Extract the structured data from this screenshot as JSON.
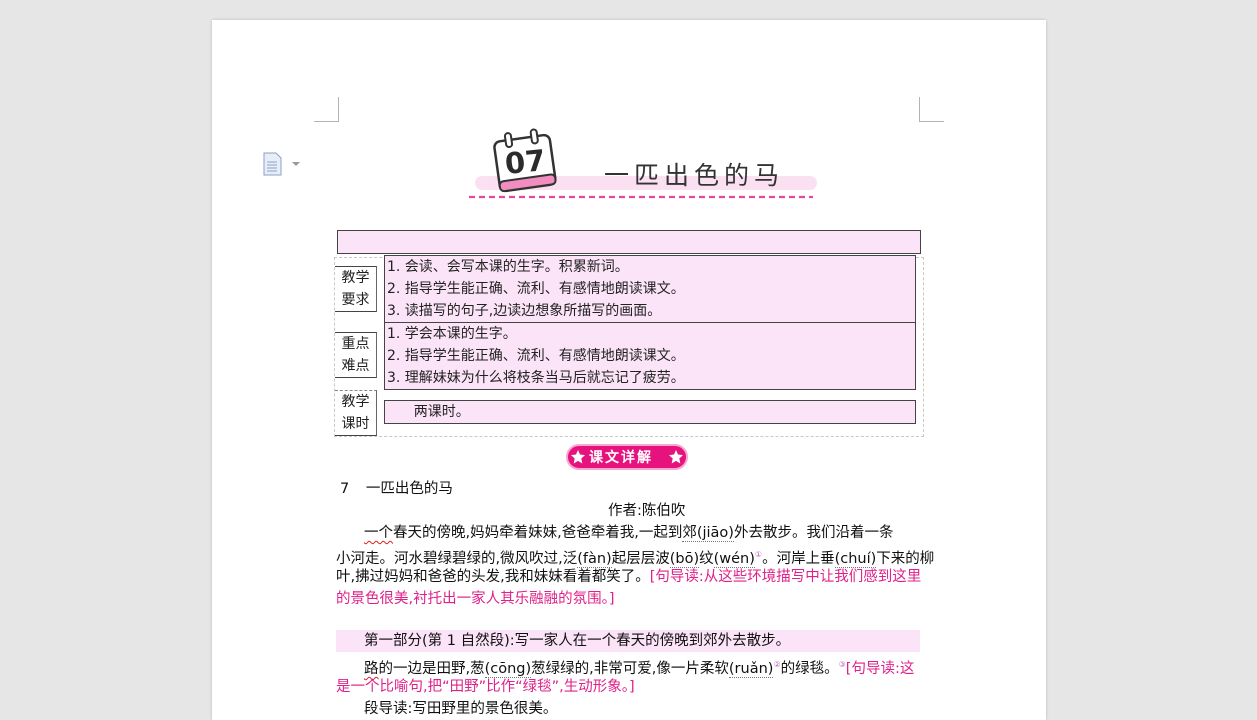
{
  "lesson": {
    "number": "07",
    "title": "一匹出色的马"
  },
  "table": {
    "header": "",
    "rows": [
      {
        "label1": "教学",
        "label2": "要求",
        "items": [
          "1. 会读、会写本课的生字。积累新词。",
          "2. 指导学生能正确、流利、有感情地朗读课文。",
          "3. 读描写的句子,边读边想象所描写的画面。"
        ]
      },
      {
        "label1": "重点",
        "label2": "难点",
        "items": [
          "1.  学会本课的生字。",
          "2. 指导学生能正确、流利、有感情地朗读课文。",
          "3. 理解妹妹为什么将枝条当马后就忘记了疲劳。"
        ]
      },
      {
        "label1": "教学",
        "label2": "课时",
        "items": [
          "      两课时。"
        ]
      }
    ]
  },
  "section_badge": "课文详解",
  "text": {
    "heading_num": "7",
    "heading_title": "一匹出色的马",
    "author": "作者:陈伯吹",
    "p1_indent": "一个",
    "p1_a": "春天的傍晚,妈妈牵着妹妹,爸爸牵着我,一起到",
    "p1_jiao": "郊(jiāo)",
    "p1_b": "外去散步。我们沿着一条",
    "p2_a": "小河走。河水碧绿碧绿的,微风吹过,泛",
    "p2_fan": "(fàn)",
    "p2_b": "起层层波",
    "p2_bo": "(bō)",
    "p2_c": "纹",
    "p2_wen": "(wén)",
    "p2_d": "。河岸上垂",
    "p2_chui": "(chuí)",
    "p2_e": "下来的柳",
    "p3_a": "叶,拂过妈妈和爸爸的头发,我和妹妹看着都笑了。",
    "p3_pink": "[句导读:从这些环境描写中让我们感到这里",
    "p4_pink": "的景色很美,衬托出一家人其乐融融的氛围。]",
    "part1": "第一部分(第 1 自然段):写一家人在一个春天的傍晚到郊外去散步。",
    "p5_indent": "路",
    "p5_a": "的一边是田野,葱",
    "p5_cong": "(cōng)",
    "p5_b": "葱绿绿的,非常可爱,像一片柔软",
    "p5_ruan": "(ruǎn)",
    "p5_c": "的绿毯。",
    "p5_pink": "[句导读:这",
    "p6_pink": "是一个比喻句,把“田野”比作“绿毯”,生动形象。]",
    "p7": "段导读:写田野里的景色很美。",
    "superscripts": [
      "①",
      "②",
      "③"
    ]
  },
  "colors": {
    "accent_pink": "#e0218a",
    "cell_bg": "#fce4f8",
    "badge": "#e6127d"
  },
  "icons": [
    "document-icon",
    "calendar-icon",
    "star-icon"
  ]
}
